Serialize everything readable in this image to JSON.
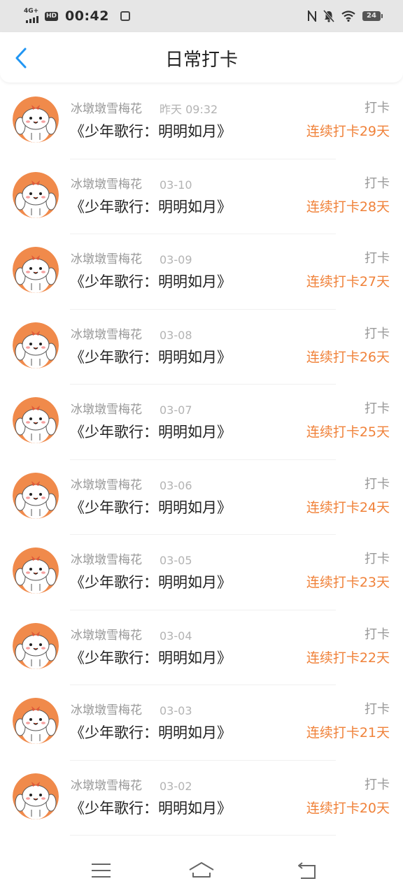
{
  "status_bar": {
    "network": "4G+",
    "hd": "HD",
    "time": "00:42",
    "battery": "24",
    "icons": [
      "signal-icon",
      "hd-icon",
      "app-notification-icon",
      "nfc-icon",
      "mute-bell-icon",
      "wifi-icon",
      "battery-icon"
    ]
  },
  "header": {
    "title": "日常打卡",
    "back_icon": "chevron-left-icon"
  },
  "colors": {
    "accent_blue": "#2196f3",
    "streak_orange": "#f0823a",
    "avatar_bg": "#f08a4b"
  },
  "items": [
    {
      "user": "冰墩墩雪梅花",
      "date": "昨天 09:32",
      "book": "《少年歌行：明明如月》",
      "action": "打卡",
      "streak": "连续打卡29天"
    },
    {
      "user": "冰墩墩雪梅花",
      "date": "03-10",
      "book": "《少年歌行：明明如月》",
      "action": "打卡",
      "streak": "连续打卡28天"
    },
    {
      "user": "冰墩墩雪梅花",
      "date": "03-09",
      "book": "《少年歌行：明明如月》",
      "action": "打卡",
      "streak": "连续打卡27天"
    },
    {
      "user": "冰墩墩雪梅花",
      "date": "03-08",
      "book": "《少年歌行：明明如月》",
      "action": "打卡",
      "streak": "连续打卡26天"
    },
    {
      "user": "冰墩墩雪梅花",
      "date": "03-07",
      "book": "《少年歌行：明明如月》",
      "action": "打卡",
      "streak": "连续打卡25天"
    },
    {
      "user": "冰墩墩雪梅花",
      "date": "03-06",
      "book": "《少年歌行：明明如月》",
      "action": "打卡",
      "streak": "连续打卡24天"
    },
    {
      "user": "冰墩墩雪梅花",
      "date": "03-05",
      "book": "《少年歌行：明明如月》",
      "action": "打卡",
      "streak": "连续打卡23天"
    },
    {
      "user": "冰墩墩雪梅花",
      "date": "03-04",
      "book": "《少年歌行：明明如月》",
      "action": "打卡",
      "streak": "连续打卡22天"
    },
    {
      "user": "冰墩墩雪梅花",
      "date": "03-03",
      "book": "《少年歌行：明明如月》",
      "action": "打卡",
      "streak": "连续打卡21天"
    },
    {
      "user": "冰墩墩雪梅花",
      "date": "03-02",
      "book": "《少年歌行：明明如月》",
      "action": "打卡",
      "streak": "连续打卡20天"
    }
  ],
  "bottom_nav": {
    "icons": [
      "menu-icon",
      "home-icon",
      "back-icon"
    ]
  }
}
